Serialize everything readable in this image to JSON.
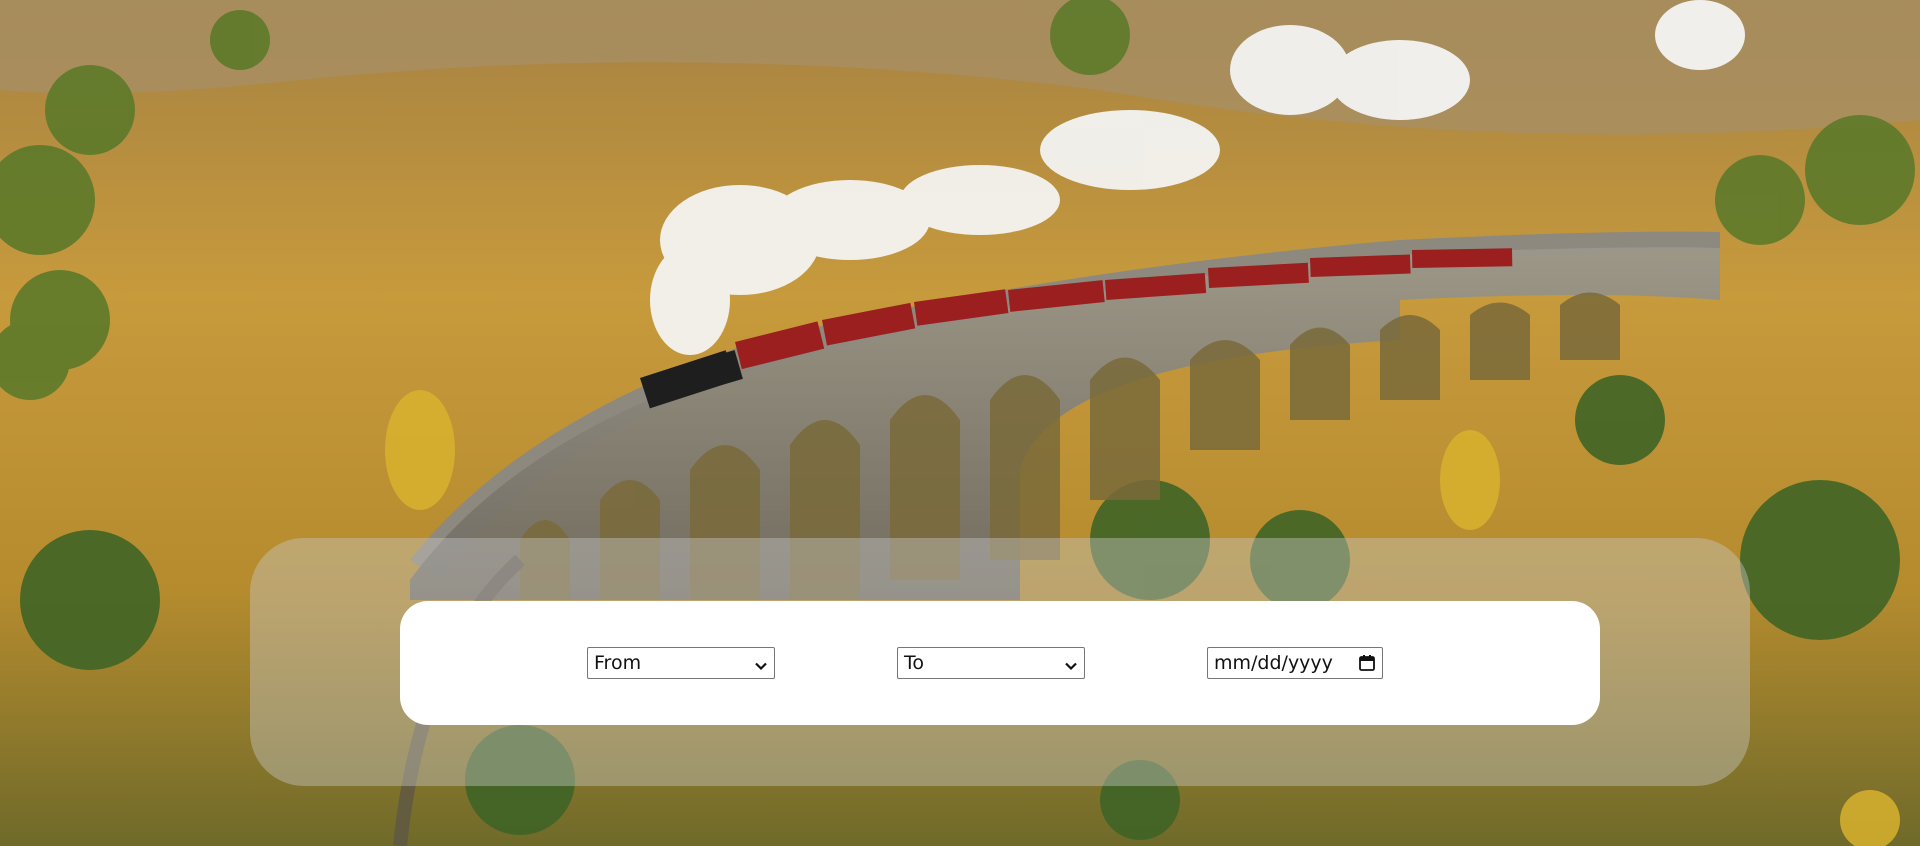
{
  "background": {
    "scene": "steam-train-viaduct-photo"
  },
  "form": {
    "from_select": {
      "selected": "From",
      "icon": "chevron-down-icon"
    },
    "to_select": {
      "selected": "To",
      "icon": "chevron-down-icon"
    },
    "date_input": {
      "placeholder": "mm/dd/yyyy",
      "icon": "calendar-icon"
    }
  },
  "colors": {
    "panel_outer": "rgba(200,200,200,0.42)",
    "panel_inner": "#ffffff",
    "field_border": "#767676"
  }
}
